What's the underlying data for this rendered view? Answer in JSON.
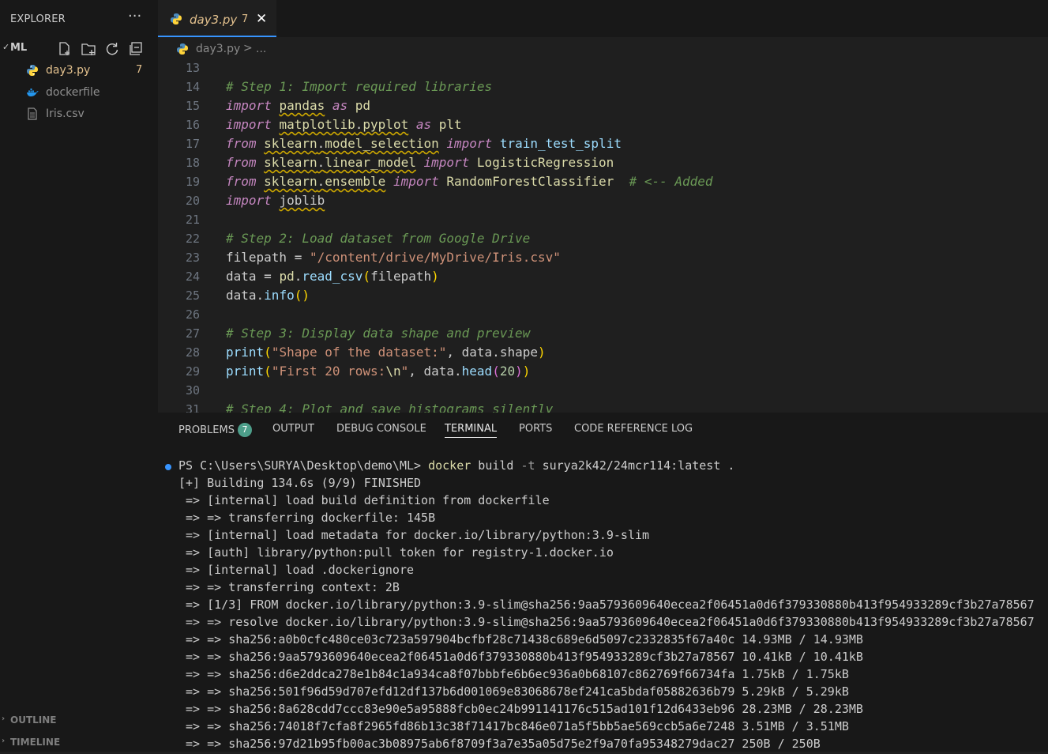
{
  "sidebar": {
    "header": "EXPLORER",
    "more": "···",
    "folder": "ML",
    "files": [
      {
        "name": "day3.py",
        "badge": "7",
        "color": "#e2c08d"
      },
      {
        "name": "dockerfile",
        "badge": "",
        "color": "#8f8f8f"
      },
      {
        "name": "Iris.csv",
        "badge": "",
        "color": "#8f8f8f"
      }
    ],
    "outline": "OUTLINE",
    "timeline": "TIMELINE"
  },
  "tab": {
    "name": "day3.py",
    "badge": "7",
    "close": "✕"
  },
  "breadcrumb": {
    "file": "day3.py",
    "sep": ">",
    "more": "..."
  },
  "editor": {
    "line_numbers": [
      "13",
      "14",
      "15",
      "16",
      "17",
      "18",
      "19",
      "20",
      "21",
      "22",
      "23",
      "24",
      "25",
      "26",
      "27",
      "28",
      "29",
      "30",
      "31"
    ],
    "comments": {
      "step1": "# Step 1: Import required libraries",
      "added": "# <-- Added",
      "step2": "# Step 2: Load dataset from Google Drive",
      "step3": "# Step 3: Display data shape and preview",
      "step4": "# Step 4: Plot and save histograms silently"
    },
    "tokens": {
      "import": "import",
      "from": "from",
      "as": "as",
      "pandas": "pandas",
      "pd": "pd",
      "matplotlib": "matplotlib",
      "pyplot": "pyplot",
      "plt": "plt",
      "sklearn": "sklearn",
      "model_selection": "model_selection",
      "train_test_split": "train_test_split",
      "linear_model": "linear_model",
      "LogisticRegression": "LogisticRegression",
      "ensemble": "ensemble",
      "RandomForestClassifier": "RandomForestClassifier",
      "joblib": "joblib",
      "filepath": "filepath",
      "path_str": "\"/content/drive/MyDrive/Iris.csv\"",
      "data": "data",
      "read_csv": "read_csv",
      "info": "info",
      "print": "print",
      "shape_str": "\"Shape of the dataset:\"",
      "shape": "shape",
      "first_str_a": "\"First 20 rows:",
      "first_esc": "\\n",
      "first_str_b": "\"",
      "head": "head",
      "twenty": "20"
    }
  },
  "panel": {
    "tabs": [
      {
        "label": "PROBLEMS",
        "badge": "7"
      },
      {
        "label": "OUTPUT"
      },
      {
        "label": "DEBUG CONSOLE"
      },
      {
        "label": "TERMINAL"
      },
      {
        "label": "PORTS"
      },
      {
        "label": "CODE REFERENCE LOG"
      }
    ],
    "terminal": {
      "prompt": "PS C:\\Users\\SURYA\\Desktop\\demo\\ML> ",
      "cmd": "docker",
      "cmd_rest": " build ",
      "flag": "-t",
      "target": " surya2k42/24mcr114:latest .",
      "lines": [
        "[+] Building 134.6s (9/9) FINISHED",
        " => [internal] load build definition from dockerfile",
        " => => transferring dockerfile: 145B",
        " => [internal] load metadata for docker.io/library/python:3.9-slim",
        " => [auth] library/python:pull token for registry-1.docker.io",
        " => [internal] load .dockerignore",
        " => => transferring context: 2B",
        " => [1/3] FROM docker.io/library/python:3.9-slim@sha256:9aa5793609640ecea2f06451a0d6f379330880b413f954933289cf3b27a78567",
        " => => resolve docker.io/library/python:3.9-slim@sha256:9aa5793609640ecea2f06451a0d6f379330880b413f954933289cf3b27a78567",
        " => => sha256:a0b0cfc480ce03c723a597904bcfbf28c71438c689e6d5097c2332835f67a40c 14.93MB / 14.93MB",
        " => => sha256:9aa5793609640ecea2f06451a0d6f379330880b413f954933289cf3b27a78567 10.41kB / 10.41kB",
        " => => sha256:d6e2ddca278e1b84c1a934ca8f07bbbfe6b6ec936a0b68107c862769f66734fa 1.75kB / 1.75kB",
        " => => sha256:501f96d59d707efd12df137b6d001069e83068678ef241ca5bdaf05882636b79 5.29kB / 5.29kB",
        " => => sha256:8a628cdd7ccc83e90e5a95888fcb0ec24b991141176c515ad101f12d6433eb96 28.23MB / 28.23MB",
        " => => sha256:74018f7cfa8f2965fd86b13c38f71417bc846e071a5f5bb5ae569ccb5a6e7248 3.51MB / 3.51MB",
        " => => sha256:97d21b95fb00ac3b08975ab6f8709f3a7e35a05d75e2f9a70fa95348279dac27 250B / 250B"
      ]
    }
  }
}
